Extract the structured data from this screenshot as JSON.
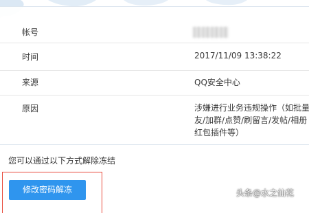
{
  "details": {
    "rows": [
      {
        "label": "帐号",
        "value": ""
      },
      {
        "label": "时间",
        "value": "2017/11/09  13:38:22"
      },
      {
        "label": "来源",
        "value": "QQ安全中心"
      },
      {
        "label": "原因",
        "value_lines": [
          "涉嫌进行业务违规操作（如批量",
          "友/加群/点赞/刷留言/发帖/相册",
          "红包插件等）"
        ]
      }
    ]
  },
  "unfreeze": {
    "hint": "您可以通过以下方式解除冻结",
    "button_label": "修改密码解冻"
  },
  "watermark": "头条@水之仙花",
  "colors": {
    "button": "#2f95ee",
    "highlight_box": "#e8493a",
    "map": "#dbe8f4"
  }
}
